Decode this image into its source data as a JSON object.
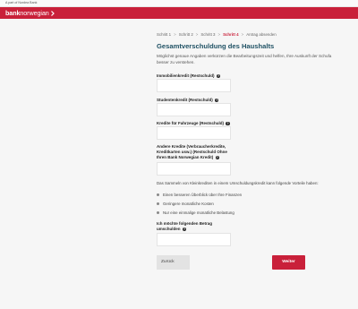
{
  "topbar": {
    "text": "A part of Nordea Bank"
  },
  "header": {
    "logo_bold": "bank",
    "logo_light": "norwegian"
  },
  "steps": {
    "items": [
      {
        "label": "Schritt 1"
      },
      {
        "label": "Schritt 2"
      },
      {
        "label": "Schritt 3"
      },
      {
        "label": "Schritt 4"
      },
      {
        "label": "Antrag absenden"
      }
    ],
    "separator": ">",
    "active_index": 3
  },
  "page": {
    "title": "Gesamtverschuldung des Haushalts",
    "intro": "Möglichst genaue Angaben verkürzen die Bearbeitungszeit und helfen, Ihre Auskunft der Schufa besser zu verstehen."
  },
  "fields": {
    "mortgage": {
      "label": "Immobilienkredit (Restschuld)",
      "value": ""
    },
    "student": {
      "label": "Studentenkredit (Restschuld)",
      "value": ""
    },
    "car": {
      "label": "Kredite für Fahrzeuge (Restschuld)",
      "value": ""
    },
    "other": {
      "label_lines": [
        "Andere Kredite (Verbraucherkredite,",
        "Kreditkarten usw.) (Restschuld Ohne",
        "Ihren Bank Norwegian Kredit)"
      ],
      "value": ""
    },
    "amount": {
      "label_lines": [
        "Ich möchte folgenden Betrag",
        "umschulden"
      ],
      "value": ""
    }
  },
  "benefits": {
    "intro": "Das Sammeln von Kleinkrediten in einem Umschuldungskredit kann folgende Vorteile haben:",
    "items": [
      "Einen besseren Überblick über Ihre Finanzen",
      "Geringere monatliche Kosten",
      "Nur eine einmalige monatliche Belastung"
    ]
  },
  "help_glyph": "?",
  "buttons": {
    "back": "Zurück",
    "next": "Weiter"
  },
  "colors": {
    "brand": "#c9203a",
    "title": "#1f5164"
  }
}
